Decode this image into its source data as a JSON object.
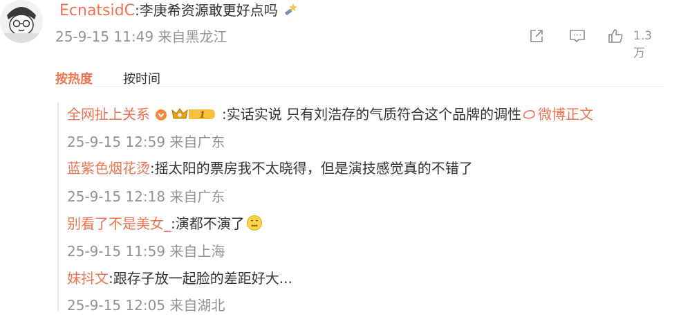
{
  "top_comment": {
    "username": "EcnatsidC",
    "text": ":李庚希资源敢更好点吗",
    "time": "25-9-15 11:49",
    "location": "来自黑龙江",
    "likes": "1.3万"
  },
  "sort_tabs": {
    "hot": "按热度",
    "time": "按时间"
  },
  "replies": [
    {
      "username": "全网扯上关系",
      "crown_level": "1",
      "text": ":实话实说 只有刘浩存的气质符合这个品牌的调性",
      "link": "微博正文",
      "meta": "25-9-15 12:59 来自广东"
    },
    {
      "username": "蓝紫色烟花烫",
      "text": ":摇太阳的票房我不太晓得，但是演技感觉真的不错了",
      "meta": "25-9-15 12:18 来自广东"
    },
    {
      "username": "别看了不是美女_",
      "text": ":演都不演了",
      "meta": "25-9-15 11:59 来自上海"
    },
    {
      "username": "妹抖文",
      "text": ":跟存子放一起脸的差距好大...",
      "meta": "25-9-15 12:05 来自湖北"
    }
  ]
}
